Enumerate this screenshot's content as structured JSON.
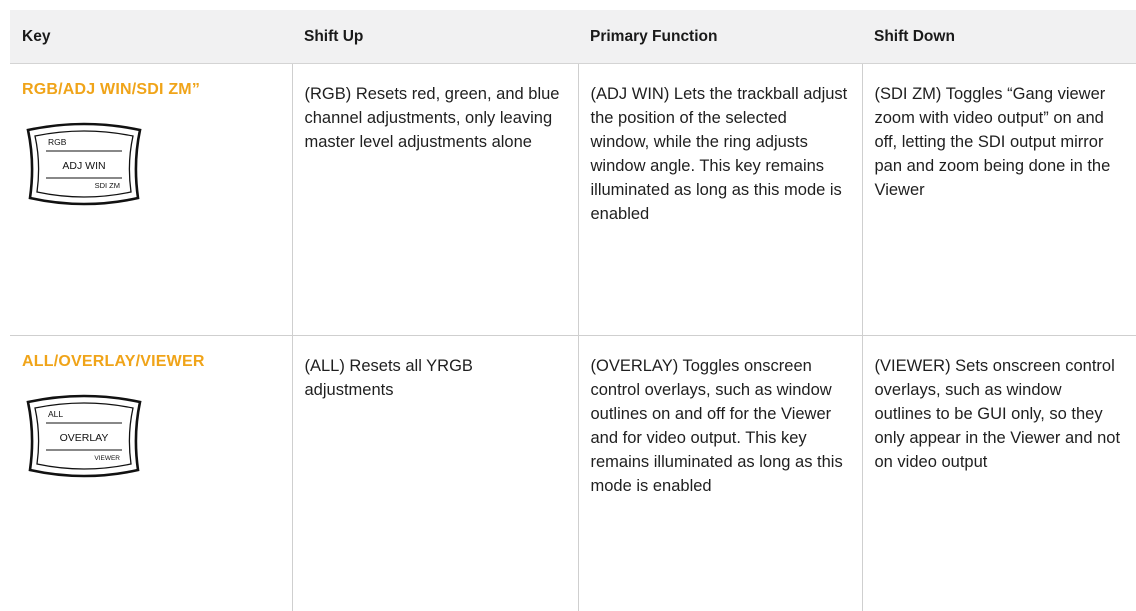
{
  "headers": [
    "Key",
    "Shift Up",
    "Primary Function",
    "Shift Down"
  ],
  "rows": [
    {
      "key": "RGB/ADJ WIN/SDI ZM”",
      "icon": {
        "top": "RGB",
        "middle": "ADJ WIN",
        "bottom": "SDI ZM"
      },
      "shift_up": "(RGB) Resets red, green, and blue channel adjustments, only leaving master level adjustments alone",
      "primary": "(ADJ WIN) Lets the trackball adjust the position of the selected window, while the ring adjusts window angle. This key remains illuminated as long as this mode is enabled",
      "shift_down": "(SDI ZM) Toggles “Gang viewer zoom with video output” on and off, letting the SDI output mirror pan and zoom being done in the Viewer"
    },
    {
      "key": "ALL/OVERLAY/VIEWER",
      "icon": {
        "top": "ALL",
        "middle": "OVERLAY",
        "bottom": "VIEWER"
      },
      "shift_up": "(ALL) Resets all YRGB adjustments",
      "primary": "(OVERLAY) Toggles onscreen control overlays, such as window outlines on and off for the Viewer and for video output. This key remains illuminated as long as this mode is enabled",
      "shift_down": "(VIEWER) Sets onscreen control overlays, such as window outlines to be GUI only, so they only appear in the Viewer and not on video output"
    }
  ],
  "colors": {
    "key_accent": "#f0a419",
    "header_bg": "#f1f1f2"
  }
}
